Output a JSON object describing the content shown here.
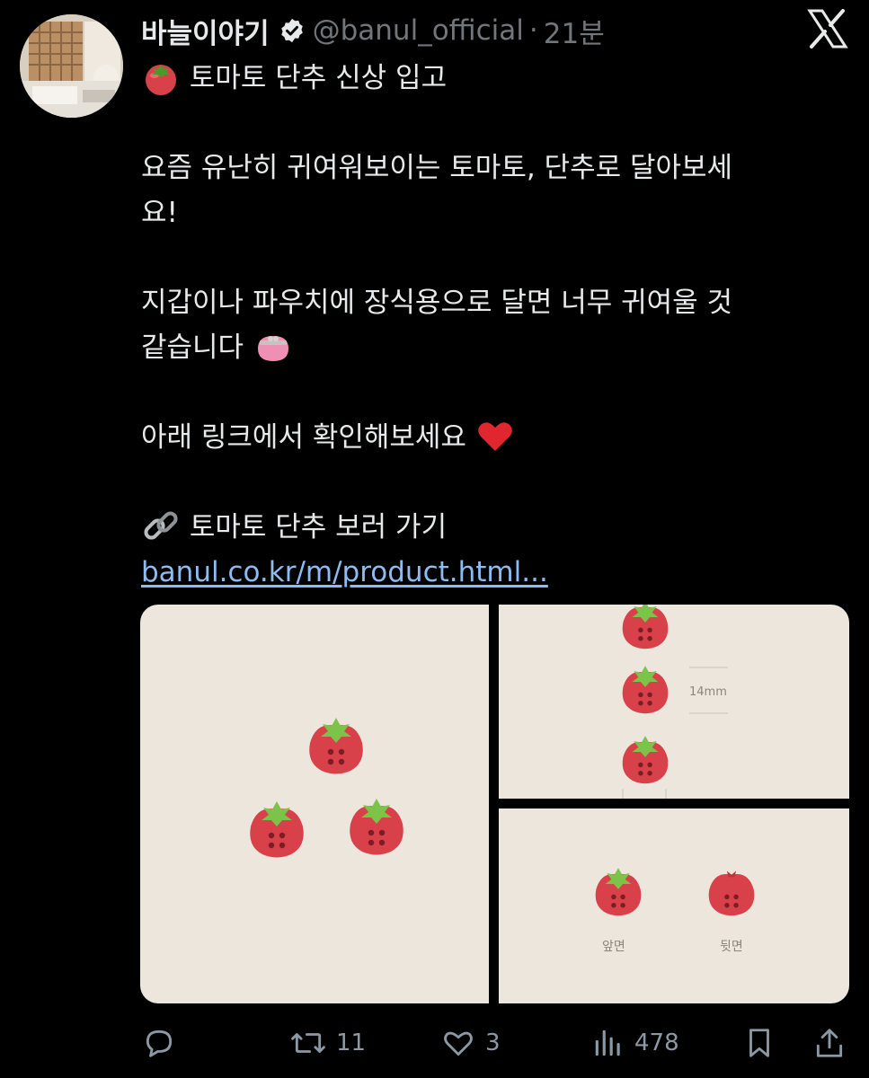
{
  "post": {
    "display_name": "바늘이야기",
    "handle": "@banul_official",
    "separator": "·",
    "time": "21분",
    "lines": {
      "l1": "토마토 단추 신상 입고",
      "l2": "요즘 유난히 귀여워보이는 토마토, 단추로 달아보세",
      "l3": "요!",
      "l4": "지갑이나 파우치에 장식용으로 달면 너무 귀여울 것",
      "l5": "같습니다",
      "l6": "아래 링크에서 확인해보세요",
      "l7": "토마토 단추 보러 가기"
    },
    "link_text": "banul.co.kr/m/product.html...",
    "media": {
      "size_label": "14mm",
      "front_label": "앞면",
      "back_label": "뒷면"
    }
  },
  "actions": {
    "reply_icon": "speech-bubble-icon",
    "repost_icon": "repost-arrows-icon",
    "repost_count": "11",
    "like_icon": "heart-icon",
    "like_count": "3",
    "views_icon": "bar-chart-icon",
    "views_count": "478",
    "bookmark_icon": "bookmark-icon",
    "share_icon": "share-upload-icon"
  },
  "colors": {
    "background": "#000000",
    "text": "#e7e9ea",
    "muted": "#71767b",
    "link": "#8bbcf2",
    "verified_badge": "#1d9bf0",
    "tomato_red": "#d8404a",
    "leaf_green": "#7cc34a",
    "media_bg": "#ede6dd"
  }
}
